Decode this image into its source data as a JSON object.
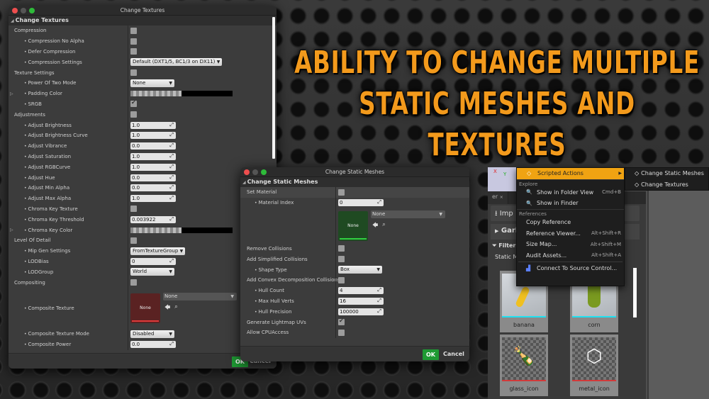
{
  "headline": {
    "line1": "Ability to change multiple",
    "line2": "static meshes and textures",
    "color": "#f39a1c"
  },
  "textures_window": {
    "title": "Change Textures",
    "section": "Change Textures",
    "rows": [
      {
        "label": "Compression",
        "type": "checkbox",
        "checked": false,
        "sub": false
      },
      {
        "label": "Compression No Alpha",
        "type": "checkbox",
        "checked": false,
        "sub": true
      },
      {
        "label": "Defer Compression",
        "type": "checkbox",
        "checked": false,
        "sub": true
      },
      {
        "label": "Compression Settings",
        "type": "dropdown",
        "value": "Default (DXT1/5, BC1/3 on DX11)",
        "sub": true
      },
      {
        "label": "Texture Settings",
        "type": "checkbox",
        "checked": false,
        "sub": false
      },
      {
        "label": "Power Of Two Mode",
        "type": "dropdown",
        "value": "None",
        "sub": true
      },
      {
        "label": "Padding Color",
        "type": "color",
        "sub": true,
        "expandable": true
      },
      {
        "label": "SRGB",
        "type": "checkbox",
        "checked": true,
        "sub": true
      },
      {
        "label": "Adjustments",
        "type": "checkbox",
        "checked": false,
        "sub": false
      },
      {
        "label": "Adjust Brightness",
        "type": "number",
        "value": "1.0",
        "sub": true
      },
      {
        "label": "Adjust Brightness Curve",
        "type": "number",
        "value": "1.0",
        "sub": true
      },
      {
        "label": "Adjust Vibrance",
        "type": "number",
        "value": "0.0",
        "sub": true
      },
      {
        "label": "Adjust Saturation",
        "type": "number",
        "value": "1.0",
        "sub": true
      },
      {
        "label": "Adjust RGBCurve",
        "type": "number",
        "value": "1.0",
        "sub": true
      },
      {
        "label": "Adjust Hue",
        "type": "number",
        "value": "0.0",
        "sub": true
      },
      {
        "label": "Adjust Min Alpha",
        "type": "number",
        "value": "0.0",
        "sub": true
      },
      {
        "label": "Adjust Max Alpha",
        "type": "number",
        "value": "1.0",
        "sub": true
      },
      {
        "label": "Chroma Key Texture",
        "type": "checkbox",
        "checked": false,
        "sub": true
      },
      {
        "label": "Chroma Key Threshold",
        "type": "number",
        "value": "0.003922",
        "sub": true
      },
      {
        "label": "Chroma Key Color",
        "type": "color",
        "sub": true,
        "expandable": true
      },
      {
        "label": "Level Of Detail",
        "type": "checkbox",
        "checked": false,
        "sub": false
      },
      {
        "label": "Mip Gen Settings",
        "type": "dropdown",
        "value": "FromTextureGroup",
        "sub": true
      },
      {
        "label": "LODBias",
        "type": "number",
        "value": "0",
        "sub": true
      },
      {
        "label": "LODGroup",
        "type": "dropdown",
        "value": "World",
        "sub": true
      },
      {
        "label": "Compositing",
        "type": "checkbox",
        "checked": false,
        "sub": false
      },
      {
        "label": "Composite Texture",
        "type": "asset",
        "thumb": "None",
        "value": "None",
        "sub": true
      },
      {
        "label": "Composite Texture Mode",
        "type": "dropdown",
        "value": "Disabled",
        "sub": true
      },
      {
        "label": "Composite Power",
        "type": "number",
        "value": "0.0",
        "sub": true
      }
    ],
    "ok": "OK",
    "cancel": "Cancel"
  },
  "meshes_window": {
    "title": "Change Static Meshes",
    "section": "Change Static Meshes",
    "rows": [
      {
        "label": "Set Material",
        "type": "checkbox",
        "checked": false,
        "sub": false
      },
      {
        "label": "Material Index",
        "type": "number",
        "value": "0",
        "sub": true
      },
      {
        "label": "",
        "type": "asset",
        "thumb": "None",
        "value": "None",
        "sub": false
      },
      {
        "label": "Remove Collisions",
        "type": "checkbox",
        "checked": false,
        "sub": false
      },
      {
        "label": "Add Simplified Collisions",
        "type": "checkbox",
        "checked": false,
        "sub": false
      },
      {
        "label": "Shape Type",
        "type": "dropdown",
        "value": "Box",
        "sub": true
      },
      {
        "label": "Add Convex Decomposition Collisions",
        "type": "checkbox",
        "checked": false,
        "sub": false
      },
      {
        "label": "Hull Count",
        "type": "number",
        "value": "4",
        "sub": true
      },
      {
        "label": "Max Hull Verts",
        "type": "number",
        "value": "16",
        "sub": true
      },
      {
        "label": "Hull Precision",
        "type": "number",
        "value": "100000",
        "sub": true
      },
      {
        "label": "Generate Lightmap UVs",
        "type": "checkbox",
        "checked": true,
        "sub": false
      },
      {
        "label": "Allow CPUAccess",
        "type": "checkbox",
        "checked": false,
        "sub": false
      }
    ],
    "ok": "OK",
    "cancel": "Cancel"
  },
  "content_browser": {
    "axis_x": "X",
    "axis_y": "Y",
    "tab_partial": "er",
    "import_label": "Imp",
    "path_label": "Garb",
    "filters_label": "Filters",
    "column_label": "Static M",
    "assets": [
      {
        "name": "banana",
        "kind": "mesh"
      },
      {
        "name": "corn",
        "kind": "mesh"
      },
      {
        "name": "glass_icon",
        "kind": "texture"
      },
      {
        "name": "metal_icon",
        "kind": "texture"
      }
    ]
  },
  "context_menu": {
    "scripted_actions": "Scripted Actions",
    "explore_header": "Explore",
    "explore_items": [
      {
        "label": "Show in Folder View",
        "shortcut": "Cmd+B"
      },
      {
        "label": "Show in Finder",
        "shortcut": ""
      }
    ],
    "references_header": "References",
    "reference_items": [
      {
        "label": "Copy Reference",
        "shortcut": ""
      },
      {
        "label": "Reference Viewer...",
        "shortcut": "Alt+Shift+R"
      },
      {
        "label": "Size Map...",
        "shortcut": "Alt+Shift+M"
      },
      {
        "label": "Audit Assets...",
        "shortcut": "Alt+Shift+A"
      }
    ],
    "source_control": "Connect To Source Control...",
    "submenu": [
      "Change Static Meshes",
      "Change Textures"
    ],
    "accent": "#f0a312"
  }
}
